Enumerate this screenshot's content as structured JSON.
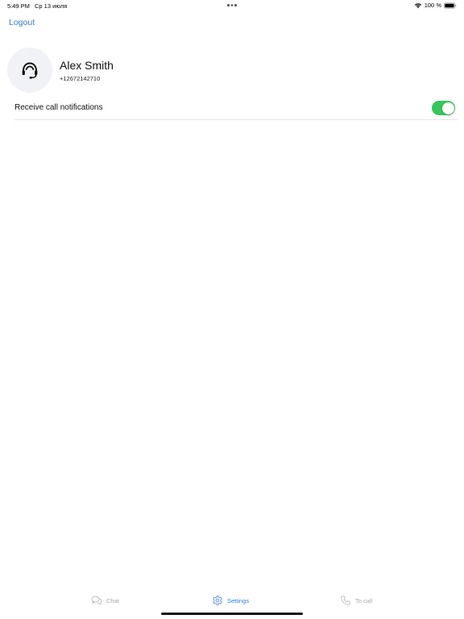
{
  "status_bar": {
    "time": "5:49 PM",
    "date": "Ср 13 июля",
    "battery": "100 %",
    "icons": [
      "wifi-icon",
      "battery-icon"
    ]
  },
  "header": {
    "logout_label": "Logout"
  },
  "profile": {
    "name": "Alex Smith",
    "phone": "+12672142710",
    "avatar_icon": "headset-agent-icon"
  },
  "settings": {
    "notifications_label": "Receive call notifications",
    "notifications_enabled": true
  },
  "tabs": [
    {
      "label": "Chat",
      "icon": "chat-bubbles-icon",
      "active": false
    },
    {
      "label": "Settings",
      "icon": "gear-icon",
      "active": true
    },
    {
      "label": "To call",
      "icon": "phone-icon",
      "active": false
    }
  ],
  "colors": {
    "accent": "#2f7fd6",
    "toggle_on": "#34c759",
    "tab_inactive": "#a9a9a9",
    "avatar_bg": "#f1f2f6"
  }
}
